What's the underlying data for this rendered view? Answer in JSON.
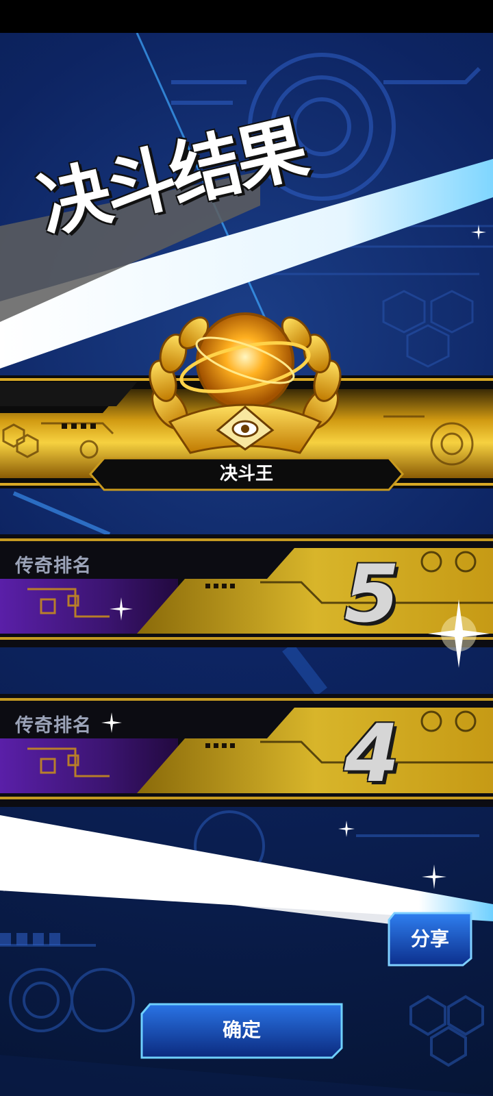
{
  "screen": {
    "title": "决斗结果",
    "rank_title": "决斗王"
  },
  "legend_rows": [
    {
      "label": "传奇排名",
      "value": "5"
    },
    {
      "label": "传奇排名",
      "value": "4"
    }
  ],
  "buttons": {
    "share": "分享",
    "confirm": "确定"
  },
  "colors": {
    "accent_gold": "#f0c020",
    "accent_blue": "#1e63c8",
    "beam": "#ffffff",
    "rank_purple": "#4b1a8c"
  },
  "icons": [
    "rank-medal-icon",
    "sparkle-icon"
  ]
}
